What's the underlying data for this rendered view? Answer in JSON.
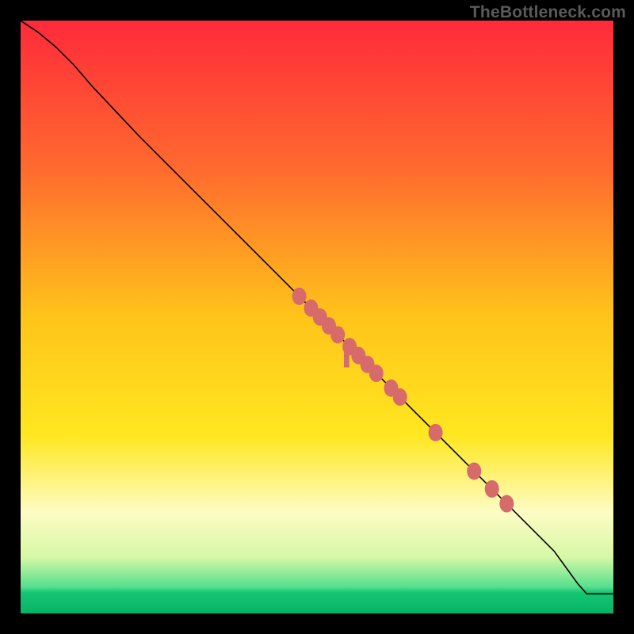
{
  "watermark": "TheBottleneck.com",
  "chart_data": {
    "type": "line",
    "title": "",
    "xlabel": "",
    "ylabel": "",
    "xlim": [
      0,
      100
    ],
    "ylim": [
      0,
      100
    ],
    "grid": false,
    "legend": false,
    "background_gradient": {
      "stops": [
        {
          "offset": 0.0,
          "color": "#ff2a3a"
        },
        {
          "offset": 0.25,
          "color": "#ff6a2e"
        },
        {
          "offset": 0.5,
          "color": "#ffc41a"
        },
        {
          "offset": 0.7,
          "color": "#ffe720"
        },
        {
          "offset": 0.83,
          "color": "#fdfcc4"
        },
        {
          "offset": 0.905,
          "color": "#d6f8a6"
        },
        {
          "offset": 0.955,
          "color": "#57e08e"
        },
        {
          "offset": 0.965,
          "color": "#14c574"
        },
        {
          "offset": 1.0,
          "color": "#06b364"
        }
      ]
    },
    "series": [
      {
        "name": "curve",
        "color": "#000000",
        "width": 1.6,
        "points": [
          {
            "x": 0.0,
            "y": 100.0
          },
          {
            "x": 3.0,
            "y": 98.0
          },
          {
            "x": 6.0,
            "y": 95.5
          },
          {
            "x": 9.0,
            "y": 92.5
          },
          {
            "x": 12.0,
            "y": 89.0
          },
          {
            "x": 20.0,
            "y": 80.5
          },
          {
            "x": 30.0,
            "y": 70.5
          },
          {
            "x": 40.0,
            "y": 60.5
          },
          {
            "x": 50.0,
            "y": 50.5
          },
          {
            "x": 60.0,
            "y": 40.5
          },
          {
            "x": 70.0,
            "y": 30.5
          },
          {
            "x": 80.0,
            "y": 20.5
          },
          {
            "x": 90.0,
            "y": 10.5
          },
          {
            "x": 94.0,
            "y": 5.0
          },
          {
            "x": 95.5,
            "y": 3.3
          },
          {
            "x": 100.0,
            "y": 3.3
          }
        ]
      }
    ],
    "markers": {
      "color": "#d76a6a",
      "rx": 9,
      "ry": 11,
      "points": [
        {
          "x": 47.0,
          "y": 53.5
        },
        {
          "x": 49.0,
          "y": 51.5
        },
        {
          "x": 50.5,
          "y": 50.0
        },
        {
          "x": 52.0,
          "y": 48.5
        },
        {
          "x": 53.5,
          "y": 47.0
        },
        {
          "x": 55.5,
          "y": 45.0
        },
        {
          "x": 57.0,
          "y": 43.5
        },
        {
          "x": 58.5,
          "y": 42.0
        },
        {
          "x": 60.0,
          "y": 40.5
        },
        {
          "x": 62.5,
          "y": 38.0
        },
        {
          "x": 64.0,
          "y": 36.5
        },
        {
          "x": 70.0,
          "y": 30.5
        },
        {
          "x": 76.5,
          "y": 24.0
        },
        {
          "x": 79.5,
          "y": 21.0
        },
        {
          "x": 82.0,
          "y": 18.5
        }
      ]
    },
    "bar_marker": {
      "color": "#d76a6a",
      "x": 55.0,
      "y_top": 45.5,
      "y_bottom": 41.5,
      "width": 0.9
    }
  }
}
